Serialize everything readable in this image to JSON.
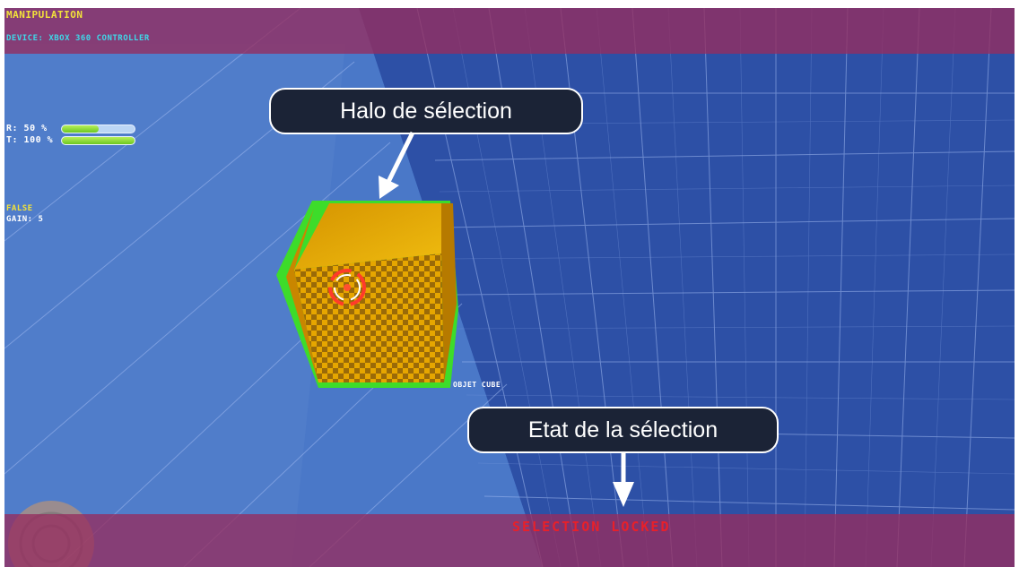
{
  "hud": {
    "mode": "MANIPULATION",
    "device": "DEVICE: XBOX 360 CONTROLLER",
    "rotation_label": "R: 50 %",
    "rotation_level": 0.5,
    "translation_label": "T: 100 %",
    "translation_level": 1.0,
    "flag": "FALSE",
    "gain": "GAIN: 5",
    "object_label": "OBJET CUBE",
    "selection_state": "SELECTION LOCKED"
  },
  "callouts": {
    "halo": "Halo de sélection",
    "etat": "Etat de la sélection"
  },
  "colors": {
    "background": "#2e52a8",
    "hud_band": "#962d5f",
    "halo": "#3ddc2a",
    "cube": "#e0a000",
    "selection_state": "#e8202a",
    "mode_text": "#f2e23a",
    "device_text": "#3fd8e8"
  }
}
